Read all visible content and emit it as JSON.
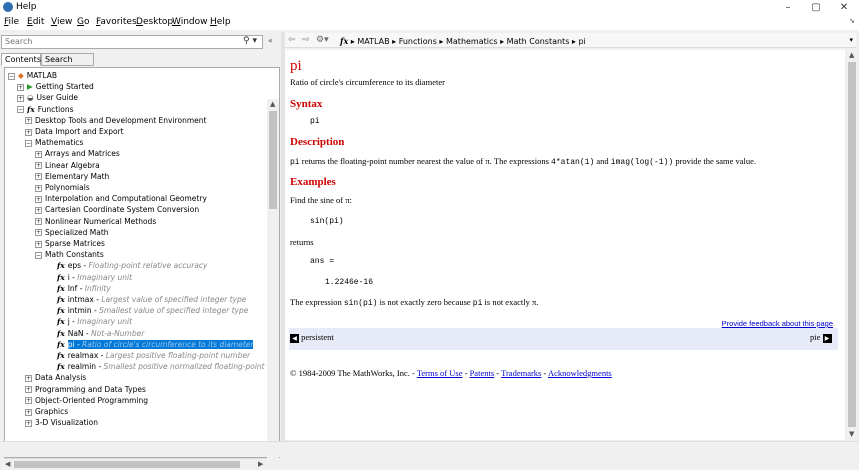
{
  "window": {
    "title": "Help",
    "minimize": "–",
    "maximize": "▢",
    "close": "✕"
  },
  "menu": [
    "File",
    "Edit",
    "View",
    "Go",
    "Favorites",
    "Desktop",
    "Window",
    "Help"
  ],
  "search": {
    "placeholder": "Search",
    "collapse": "«"
  },
  "tabs": [
    "Contents",
    "Search Results"
  ],
  "tree": [
    {
      "level": 0,
      "exp": "⊟",
      "icon": "matlab",
      "label": "MATLAB"
    },
    {
      "level": 1,
      "exp": "⊞",
      "icon": "play",
      "label": "Getting Started"
    },
    {
      "level": 1,
      "exp": "⊞",
      "icon": "book",
      "label": "User Guide"
    },
    {
      "level": 1,
      "exp": "⊟",
      "icon": "fx",
      "label": "Functions"
    },
    {
      "level": 2,
      "exp": "⊞",
      "label": "Desktop Tools and Development Environment"
    },
    {
      "level": 2,
      "exp": "⊞",
      "label": "Data Import and Export"
    },
    {
      "level": 2,
      "exp": "⊟",
      "label": "Mathematics"
    },
    {
      "level": 3,
      "exp": "⊞",
      "label": "Arrays and Matrices"
    },
    {
      "level": 3,
      "exp": "⊞",
      "label": "Linear Algebra"
    },
    {
      "level": 3,
      "exp": "⊞",
      "label": "Elementary Math"
    },
    {
      "level": 3,
      "exp": "⊞",
      "label": "Polynomials"
    },
    {
      "level": 3,
      "exp": "⊞",
      "label": "Interpolation and Computational Geometry"
    },
    {
      "level": 3,
      "exp": "⊞",
      "label": "Cartesian Coordinate System Conversion"
    },
    {
      "level": 3,
      "exp": "⊞",
      "label": "Nonlinear Numerical Methods"
    },
    {
      "level": 3,
      "exp": "⊞",
      "label": "Specialized Math"
    },
    {
      "level": 3,
      "exp": "⊞",
      "label": "Sparse Matrices"
    },
    {
      "level": 3,
      "exp": "⊟",
      "label": "Math Constants"
    },
    {
      "level": 4,
      "fx": true,
      "label": "eps",
      "desc": "Floating-point relative accuracy"
    },
    {
      "level": 4,
      "fx": true,
      "label": "i",
      "desc": "Imaginary unit"
    },
    {
      "level": 4,
      "fx": true,
      "label": "Inf",
      "desc": "Infinity"
    },
    {
      "level": 4,
      "fx": true,
      "label": "intmax",
      "desc": "Largest value of specified integer type"
    },
    {
      "level": 4,
      "fx": true,
      "label": "intmin",
      "desc": "Smallest value of specified integer type"
    },
    {
      "level": 4,
      "fx": true,
      "label": "j",
      "desc": "Imaginary unit"
    },
    {
      "level": 4,
      "fx": true,
      "label": "NaN",
      "desc": "Not-a-Number"
    },
    {
      "level": 4,
      "fx": true,
      "label": "pi",
      "desc": "Ratio of circle's circumference to its diameter",
      "selected": true
    },
    {
      "level": 4,
      "fx": true,
      "label": "realmax",
      "desc": "Largest positive floating-point number"
    },
    {
      "level": 4,
      "fx": true,
      "label": "realmin",
      "desc": "Smallest positive normalized floating-point numb"
    },
    {
      "level": 2,
      "exp": "⊞",
      "label": "Data Analysis"
    },
    {
      "level": 2,
      "exp": "⊞",
      "label": "Programming and Data Types"
    },
    {
      "level": 2,
      "exp": "⊞",
      "label": "Object-Oriented Programming"
    },
    {
      "level": 2,
      "exp": "⊞",
      "label": "Graphics"
    },
    {
      "level": 2,
      "exp": "⊞",
      "label": "3-D Visualization"
    }
  ],
  "breadcrumb": [
    "fx",
    "MATLAB",
    "Functions",
    "Mathematics",
    "Math Constants",
    "pi"
  ],
  "doc": {
    "title": "pi",
    "subtitle": "Ratio of circle's circumference to its diameter",
    "syntax_h": "Syntax",
    "syntax_code": "pi",
    "desc_h": "Description",
    "desc_a": "pi",
    "desc_b": " returns the floating-point number nearest the value of π. The expressions ",
    "desc_c": "4*atan(1)",
    "desc_d": " and ",
    "desc_e": "imag(log(-1))",
    "desc_f": " provide the same value.",
    "ex_h": "Examples",
    "ex_text": "Find the sine of π:",
    "ex_code": "sin(pi)",
    "returns": "returns",
    "ans": "ans =",
    "ans_val": "1.2246e-16",
    "note_a": "The expression ",
    "note_b": "sin(pi)",
    "note_c": " is not exactly zero because ",
    "note_d": "pi",
    "note_e": " is not exactly π.",
    "feedback": "Provide feedback about this page",
    "prev": "persistent",
    "next": "pie",
    "copyright": "© 1984-2009 The MathWorks, Inc. - ",
    "links": [
      "Terms of Use",
      "Patents",
      "Trademarks",
      "Acknowledgments"
    ]
  }
}
